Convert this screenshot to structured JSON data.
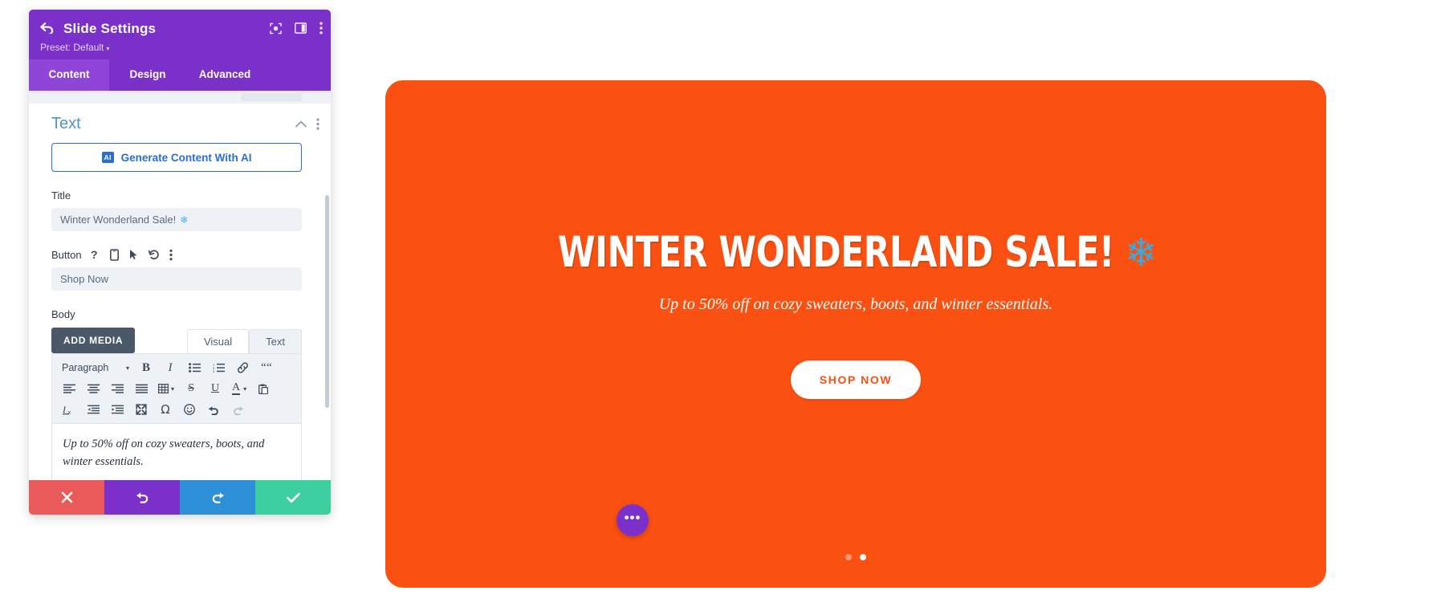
{
  "panel": {
    "header": {
      "title": "Slide Settings",
      "back_icon": "back-arrow-icon",
      "preset_label": "Preset: Default",
      "preset_caret": "▾",
      "icons": [
        "focus-target-icon",
        "split-layout-icon",
        "more-options-icon"
      ]
    },
    "tabs": [
      {
        "label": "Content",
        "active": true
      },
      {
        "label": "Design",
        "active": false
      },
      {
        "label": "Advanced",
        "active": false
      }
    ],
    "section": {
      "title": "Text",
      "collapse_icon": "chevron-up-icon",
      "menu_icon": "more-options-icon"
    },
    "ai_button": {
      "badge": "AI",
      "label": "Generate Content With AI"
    },
    "fields": {
      "title": {
        "label": "Title",
        "value": "Winter Wonderland Sale!",
        "emoji": "❄"
      },
      "button": {
        "label": "Button",
        "value": "Shop Now",
        "icons": [
          "help-icon",
          "responsive-mobile-icon",
          "hover-cursor-icon",
          "reset-undo-icon",
          "more-options-icon"
        ]
      },
      "body": {
        "label": "Body",
        "add_media_label": "ADD MEDIA",
        "editor_tabs": [
          {
            "label": "Visual",
            "active": true
          },
          {
            "label": "Text",
            "active": false
          }
        ],
        "content": "Up to 50% off on cozy sweaters, boots, and winter essentials."
      }
    },
    "toolbar": {
      "row1": [
        {
          "name": "paragraph-format-select",
          "label": "Paragraph",
          "type": "select"
        },
        {
          "name": "bold-icon",
          "label": "B",
          "type": "bold"
        },
        {
          "name": "italic-icon",
          "label": "I",
          "type": "italic"
        },
        {
          "name": "bullet-list-icon",
          "label": "",
          "type": "ul"
        },
        {
          "name": "numbered-list-icon",
          "label": "",
          "type": "ol"
        },
        {
          "name": "link-icon",
          "label": "",
          "type": "link"
        },
        {
          "name": "blockquote-icon",
          "label": "❝",
          "type": "quote"
        }
      ],
      "row2": [
        {
          "name": "align-left-icon",
          "type": "alignleft"
        },
        {
          "name": "align-center-icon",
          "type": "aligncenter"
        },
        {
          "name": "align-right-icon",
          "type": "alignright"
        },
        {
          "name": "align-justify-icon",
          "type": "alignjustify"
        },
        {
          "name": "table-icon",
          "type": "table"
        },
        {
          "name": "strikethrough-icon",
          "label": "S",
          "type": "strike"
        },
        {
          "name": "underline-icon",
          "label": "U",
          "type": "underline"
        },
        {
          "name": "text-color-icon",
          "label": "A",
          "type": "color"
        },
        {
          "name": "paste-icon",
          "type": "paste"
        }
      ],
      "row3": [
        {
          "name": "clear-formatting-icon",
          "type": "clearformat"
        },
        {
          "name": "outdent-icon",
          "type": "outdent"
        },
        {
          "name": "indent-icon",
          "type": "indent"
        },
        {
          "name": "fullscreen-icon",
          "type": "fullscreen"
        },
        {
          "name": "special-character-icon",
          "label": "Ω",
          "type": "omega"
        },
        {
          "name": "emoji-icon",
          "label": "☺",
          "type": "emoji"
        },
        {
          "name": "undo-icon",
          "type": "undo"
        },
        {
          "name": "redo-icon",
          "type": "redo",
          "disabled": true
        }
      ]
    },
    "actions": [
      {
        "name": "discard-button",
        "icon": "✖",
        "color": "#eb5a5a"
      },
      {
        "name": "undo-button",
        "icon": "↺",
        "color": "#7b31c9"
      },
      {
        "name": "redo-button",
        "icon": "↻",
        "color": "#2d8fd5"
      },
      {
        "name": "save-button",
        "icon": "✔",
        "color": "#3ecfa0"
      }
    ]
  },
  "slide": {
    "background_color": "#fa5011",
    "title": "WINTER WONDERLAND SALE!",
    "title_emoji": "❄",
    "subtitle": "Up to 50% off on cozy sweaters, boots, and winter essentials.",
    "cta_label": "SHOP NOW",
    "dots": [
      {
        "active": false
      },
      {
        "active": true
      }
    ],
    "fab_icon": "•••"
  }
}
